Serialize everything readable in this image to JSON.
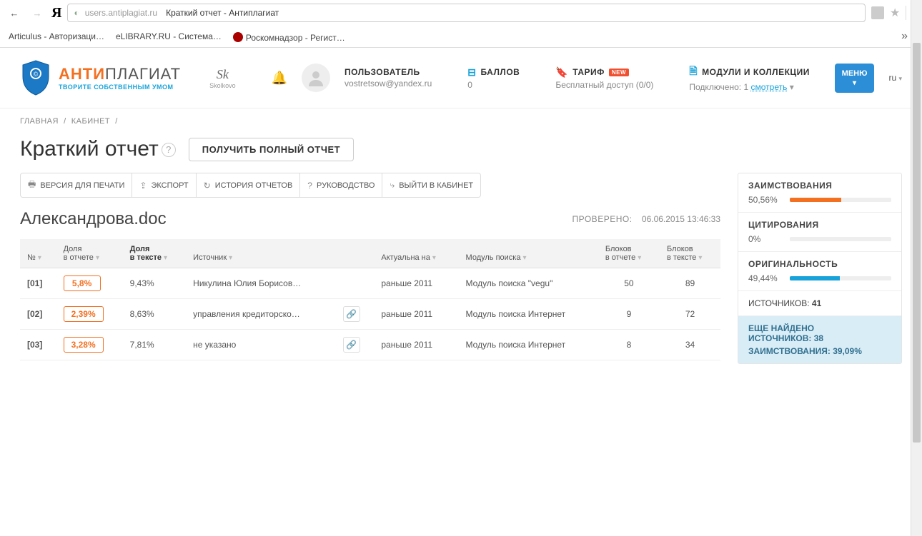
{
  "browser": {
    "url_host": "users.antiplagiat.ru",
    "url_title": "Краткий отчет - Антиплагиат",
    "bookmarks": {
      "b1": "Articulus - Авторизаци…",
      "b2": "eLIBRARY.RU - Система…",
      "b3": "Роскомнадзор - Регист…"
    }
  },
  "header": {
    "logo_anti": "АНТИ",
    "logo_plagiat": "ПЛАГИАТ",
    "logo_sub": "ТВОРИТЕ СОБСТВЕННЫМ УМОМ",
    "sk": "Sk",
    "sk_sub": "Skolkovo",
    "user_label": "ПОЛЬЗОВАТЕЛЬ",
    "user_email": "vostretsow@yandex.ru",
    "balance_label": "БАЛЛОВ",
    "balance_value": "0",
    "tariff_label": "ТАРИФ",
    "tariff_badge": "NEW",
    "tariff_value": "Бесплатный доступ (0/0)",
    "modules_label": "МОДУЛИ И КОЛЛЕКЦИИ",
    "modules_prefix": "Подключено: ",
    "modules_count": "1",
    "modules_link": "смотреть",
    "menu": "МЕНЮ",
    "lang": "ru"
  },
  "crumbs": {
    "home": "ГЛАВНАЯ",
    "cabinet": "КАБИНЕТ"
  },
  "title": "Краткий отчет",
  "full_report_btn": "ПОЛУЧИТЬ ПОЛНЫЙ ОТЧЕТ",
  "toolbar": {
    "print": "ВЕРСИЯ ДЛЯ ПЕЧАТИ",
    "export": "ЭКСПОРТ",
    "history": "ИСТОРИЯ ОТЧЕТОВ",
    "manual": "РУКОВОДСТВО",
    "exit": "ВЫЙТИ В КАБИНЕТ"
  },
  "doc": {
    "name": "Александрова.doc",
    "checked_label": "ПРОВЕРЕНО:",
    "checked_at": "06.06.2015 13:46:33"
  },
  "table": {
    "headers": {
      "num": "№",
      "share_report_a": "Доля",
      "share_report_b": "в отчете",
      "share_text_a": "Доля",
      "share_text_b": "в тексте",
      "source": "Источник",
      "actual": "Актуальна на",
      "module": "Модуль поиска",
      "blocks_report_a": "Блоков",
      "blocks_report_b": "в отчете",
      "blocks_text_a": "Блоков",
      "blocks_text_b": "в тексте"
    },
    "rows": [
      {
        "num": "[01]",
        "share_report": "5,8%",
        "share_text": "9,43%",
        "source": "Никулина Юлия Борисов…",
        "link": false,
        "actual": "раньше 2011",
        "module": "Модуль поиска \"vegu\"",
        "blocks_report": "50",
        "blocks_text": "89"
      },
      {
        "num": "[02]",
        "share_report": "2,39%",
        "share_text": "8,63%",
        "source": "управления кредиторско…",
        "link": true,
        "actual": "раньше 2011",
        "module": "Модуль поиска Интернет",
        "blocks_report": "9",
        "blocks_text": "72"
      },
      {
        "num": "[03]",
        "share_report": "3,28%",
        "share_text": "7,81%",
        "source": "не указано",
        "link": true,
        "actual": "раньше 2011",
        "module": "Модуль поиска Интернет",
        "blocks_report": "8",
        "blocks_text": "34"
      }
    ]
  },
  "side": {
    "borrow_label": "ЗАИМСТВОВАНИЯ",
    "borrow_pct": "50,56%",
    "borrow_width": "50.56%",
    "cite_label": "ЦИТИРОВАНИЯ",
    "cite_pct": "0%",
    "cite_width": "0%",
    "orig_label": "ОРИГИНАЛЬНОСТЬ",
    "orig_pct": "49,44%",
    "orig_width": "49.44%",
    "sources_label": "ИСТОЧНИКОВ:",
    "sources_count": "41",
    "more_label": "ЕЩЕ НАЙДЕНО ИСТОЧНИКОВ:",
    "more_count": "38",
    "more_borrow_label": "ЗАИМСТВОВАНИЯ:",
    "more_borrow_pct": "39,09%"
  }
}
